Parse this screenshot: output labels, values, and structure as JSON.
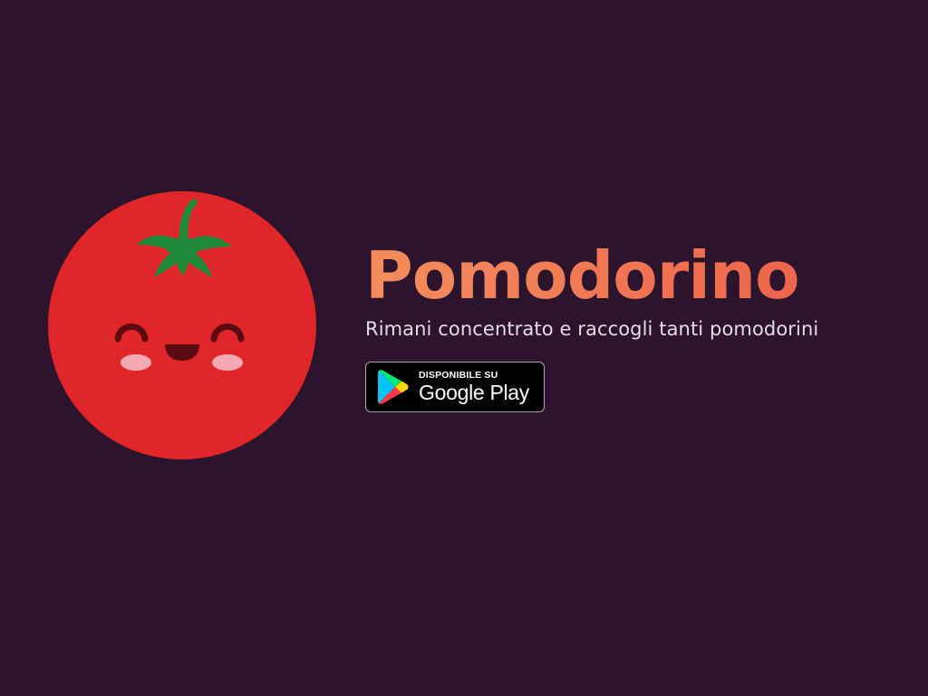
{
  "app": {
    "title": "Pomodorino",
    "tagline": "Rimani concentrato e raccogli tanti pomodorini"
  },
  "store_badge": {
    "top_label": "DISPONIBILE SU",
    "store_name": "Google Play",
    "icon": "google-play-icon"
  },
  "mascot": {
    "icon": "tomato-mascot-icon"
  },
  "colors": {
    "background": "#2c142d",
    "tomato_red": "#e02628",
    "leaf_green": "#1f8a3a",
    "title_gradient_start": "#f58d5c",
    "title_gradient_end": "#ec5a48",
    "tagline": "#e6dbe7",
    "cheek_pink": "#f7a9b1",
    "face_dark": "#5c0c10"
  }
}
